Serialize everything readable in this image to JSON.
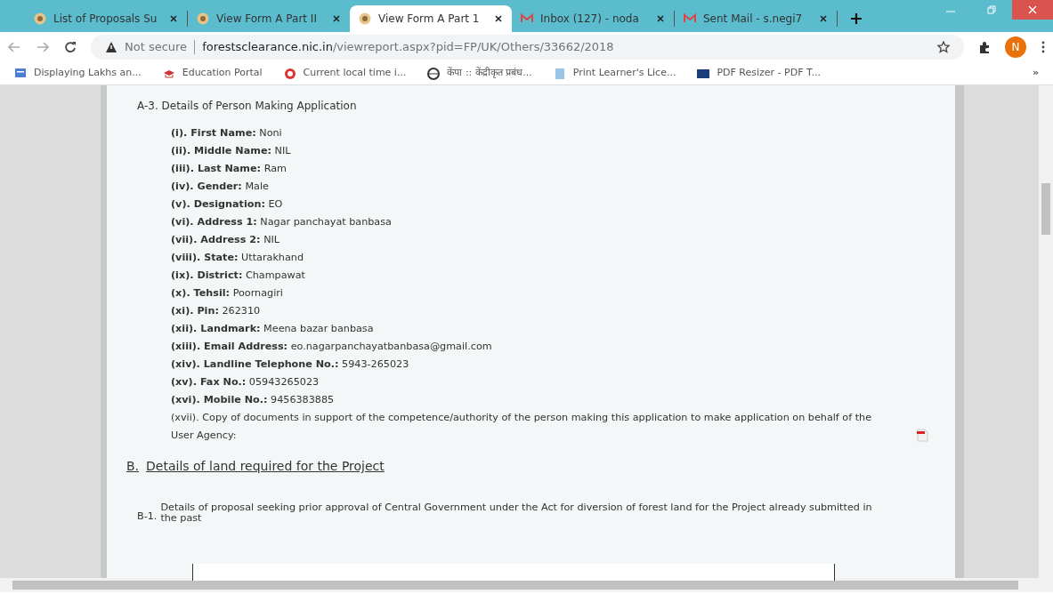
{
  "tabs": [
    {
      "title": "List of Proposals Su",
      "kind": "site",
      "selected": false
    },
    {
      "title": "View Form A Part II",
      "kind": "site",
      "selected": false
    },
    {
      "title": "View Form A Part 1",
      "kind": "site",
      "selected": true
    },
    {
      "title": "Inbox (127) - noda",
      "kind": "mail",
      "selected": false
    },
    {
      "title": "Sent Mail - s.negi7",
      "kind": "mail",
      "selected": false
    }
  ],
  "address_bar": {
    "security": "Not secure",
    "host": "forestsclearance.nic.in",
    "path": "/viewreport.aspx?pid=FP/UK/Others/33662/2018"
  },
  "profile": "N",
  "bookmarks": [
    {
      "title": "Displaying Lakhs an..."
    },
    {
      "title": "Education Portal"
    },
    {
      "title": "Current local time i..."
    },
    {
      "title": "केंपा :: केंद्रीकृत प्रबंध..."
    },
    {
      "title": "Print Learner's Lice..."
    },
    {
      "title": "PDF Resizer - PDF T..."
    }
  ],
  "bookmarks_more": "»",
  "section_a3": {
    "heading": "A-3. Details of Person Making Application",
    "items": [
      {
        "label": "(i). First Name:",
        "value": "Noni"
      },
      {
        "label": "(ii). Middle Name:",
        "value": "NIL"
      },
      {
        "label": "(iii). Last Name:",
        "value": "Ram"
      },
      {
        "label": "(iv). Gender:",
        "value": "Male"
      },
      {
        "label": "(v). Designation:",
        "value": "EO"
      },
      {
        "label": "(vi). Address 1:",
        "value": "Nagar panchayat banbasa"
      },
      {
        "label": "(vii). Address 2:",
        "value": "NIL"
      },
      {
        "label": "(viii). State:",
        "value": "Uttarakhand"
      },
      {
        "label": "(ix). District:",
        "value": "Champawat"
      },
      {
        "label": "(x). Tehsil:",
        "value": "Poornagiri"
      },
      {
        "label": "(xi). Pin:",
        "value": "262310"
      },
      {
        "label": "(xii). Landmark:",
        "value": "Meena bazar banbasa"
      },
      {
        "label": "(xiii). Email Address:",
        "value": "eo.nagarpanchayatbanbasa@gmail.com"
      },
      {
        "label": "(xiv). Landline Telephone No.:",
        "value": "5943-265023"
      },
      {
        "label": "(xv). Fax No.:",
        "value": "05943265023"
      },
      {
        "label": "(xvi). Mobile No.:",
        "value": "9456383885"
      }
    ],
    "document": {
      "text": "(xvii). Copy of documents in support of the competence/authority of the person making this application to make application on behalf of the User Agency:"
    }
  },
  "section_b": {
    "marker": "B.",
    "heading": "Details of land required for the Project",
    "sub_number": "B-1.",
    "sub_text": "Details of proposal seeking prior approval of Central Government under the Act for diversion of forest land for the Project already submitted in the past"
  }
}
